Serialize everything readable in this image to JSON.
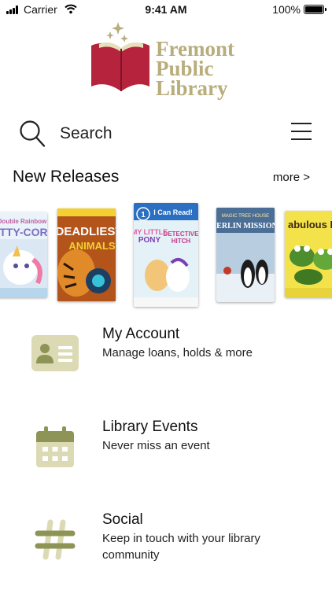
{
  "status_bar": {
    "carrier": "Carrier",
    "time": "9:41 AM",
    "battery": "100%"
  },
  "logo": {
    "line1": "Fremont",
    "line2": "Public",
    "line3": "Library",
    "colors": {
      "book": "#b5243c",
      "text": "#b8ad7c"
    }
  },
  "search": {
    "label": "Search"
  },
  "new_releases": {
    "title": "New Releases",
    "more": "more >",
    "books": [
      {
        "cover_title": "Kitty-Corn",
        "color": "#dbe8f3",
        "accent": "#7b6fc4"
      },
      {
        "cover_title": "Deadliest Animals",
        "color": "#c9651e",
        "accent": "#f3d132"
      },
      {
        "cover_title": "I Can Read! My Little Pony Detective Hitch",
        "color": "#d9ecf4",
        "accent": "#e35aa1"
      },
      {
        "cover_title": "Merlin Missions",
        "color": "#3d5e86",
        "accent": "#ffffff"
      },
      {
        "cover_title": "Fabulous Frogs",
        "color": "#f3e24a",
        "accent": "#4d8d2e"
      }
    ]
  },
  "menu": [
    {
      "title": "My Account",
      "subtitle": "Manage loans, holds & more",
      "icon": "id-card-icon"
    },
    {
      "title": "Library Events",
      "subtitle": "Never miss an event",
      "icon": "calendar-icon"
    },
    {
      "title": "Social",
      "subtitle": "Keep in touch with your library community",
      "icon": "hashtag-icon"
    }
  ],
  "colors": {
    "icon_olive": "#8e9356",
    "icon_light": "#dcdab4"
  }
}
